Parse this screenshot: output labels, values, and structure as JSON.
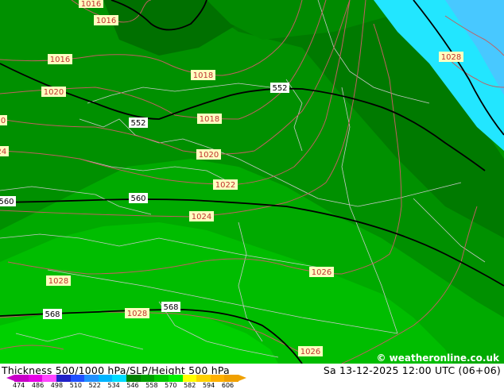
{
  "map": {
    "colors": {
      "land_dark": "#007a00",
      "band_532": "#009600",
      "band_540": "#00aa00",
      "band_548": "#00bd00",
      "band_556": "#00d000",
      "sea_cyan": "#22e6ff",
      "sea_light": "#48c8ff",
      "isobar": "#c06060",
      "height_line": "#000000",
      "border": "#c8c8c8"
    },
    "isobar_labels": [
      "1016",
      "1016",
      "1016",
      "1018",
      "1018",
      "1020",
      "1020",
      "1022",
      "1024",
      "1026",
      "1028",
      "1028",
      "1028",
      "1026",
      "1020",
      "1022",
      "1024"
    ],
    "height_labels": [
      "552",
      "552",
      "560",
      "560",
      "568",
      "568"
    ]
  },
  "footer": {
    "title": "Thickness 500/1000 hPa/SLP/Height 500 hPa",
    "datetime": "Sa 13-12-2025 12:00 UTC (06+06)",
    "credit": "© weatheronline.co.uk",
    "scale_values": [
      "474",
      "486",
      "498",
      "510",
      "522",
      "534",
      "546",
      "558",
      "570",
      "582",
      "594",
      "606"
    ],
    "scale_colors": [
      "#c800c8",
      "#e600e6",
      "#ff46ff",
      "#2020c8",
      "#2050ff",
      "#2090ff",
      "#00b4ff",
      "#00dcff",
      "#008000",
      "#00a000",
      "#00c800",
      "#00f000",
      "#ffff00",
      "#ffd000",
      "#ffb000",
      "#f0a000"
    ]
  }
}
